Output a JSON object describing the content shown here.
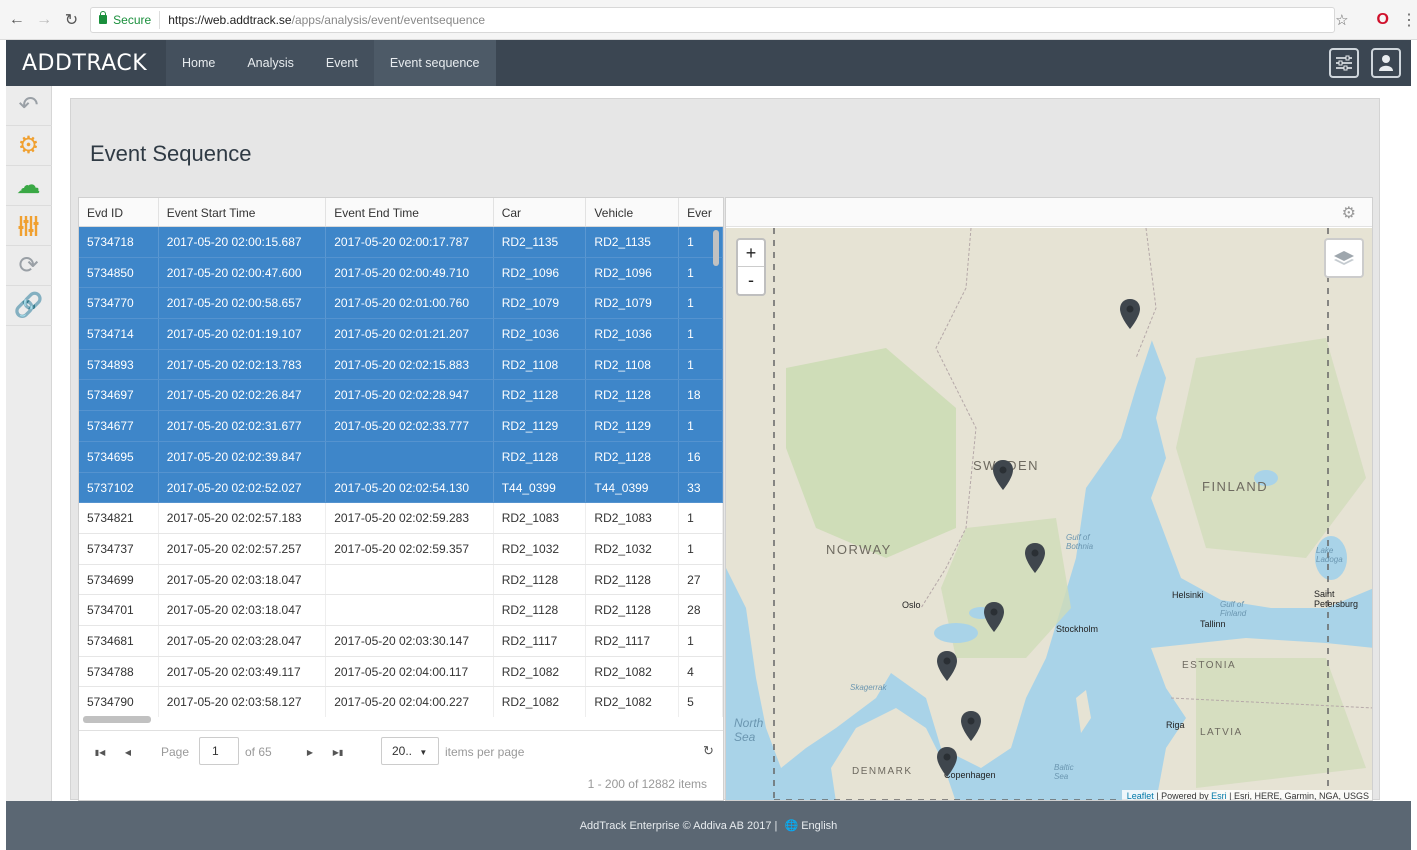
{
  "browser": {
    "secure_label": "Secure",
    "url_host": "https://web.addtrack.se",
    "url_path": "/apps/analysis/event/eventsequence"
  },
  "header": {
    "logo": "ADDTRACK",
    "nav": [
      "Home",
      "Analysis",
      "Event",
      "Event sequence"
    ]
  },
  "page": {
    "title": "Event Sequence"
  },
  "grid": {
    "columns": [
      "Evd ID",
      "Event Start Time",
      "Event End Time",
      "Car",
      "Vehicle",
      "Ever"
    ],
    "rows": [
      {
        "id": "5734718",
        "start": "2017-05-20 02:00:15.687",
        "end": "2017-05-20 02:00:17.787",
        "car": "RD2_1135",
        "vehicle": "RD2_1135",
        "ev": "1",
        "selected": true
      },
      {
        "id": "5734850",
        "start": "2017-05-20 02:00:47.600",
        "end": "2017-05-20 02:00:49.710",
        "car": "RD2_1096",
        "vehicle": "RD2_1096",
        "ev": "1",
        "selected": true
      },
      {
        "id": "5734770",
        "start": "2017-05-20 02:00:58.657",
        "end": "2017-05-20 02:01:00.760",
        "car": "RD2_1079",
        "vehicle": "RD2_1079",
        "ev": "1",
        "selected": true
      },
      {
        "id": "5734714",
        "start": "2017-05-20 02:01:19.107",
        "end": "2017-05-20 02:01:21.207",
        "car": "RD2_1036",
        "vehicle": "RD2_1036",
        "ev": "1",
        "selected": true
      },
      {
        "id": "5734893",
        "start": "2017-05-20 02:02:13.783",
        "end": "2017-05-20 02:02:15.883",
        "car": "RD2_1108",
        "vehicle": "RD2_1108",
        "ev": "1",
        "selected": true
      },
      {
        "id": "5734697",
        "start": "2017-05-20 02:02:26.847",
        "end": "2017-05-20 02:02:28.947",
        "car": "RD2_1128",
        "vehicle": "RD2_1128",
        "ev": "18",
        "selected": true
      },
      {
        "id": "5734677",
        "start": "2017-05-20 02:02:31.677",
        "end": "2017-05-20 02:02:33.777",
        "car": "RD2_1129",
        "vehicle": "RD2_1129",
        "ev": "1",
        "selected": true
      },
      {
        "id": "5734695",
        "start": "2017-05-20 02:02:39.847",
        "end": "",
        "car": "RD2_1128",
        "vehicle": "RD2_1128",
        "ev": "16",
        "selected": true
      },
      {
        "id": "5737102",
        "start": "2017-05-20 02:02:52.027",
        "end": "2017-05-20 02:02:54.130",
        "car": "T44_0399",
        "vehicle": "T44_0399",
        "ev": "33",
        "selected": true
      },
      {
        "id": "5734821",
        "start": "2017-05-20 02:02:57.183",
        "end": "2017-05-20 02:02:59.283",
        "car": "RD2_1083",
        "vehicle": "RD2_1083",
        "ev": "1",
        "selected": false
      },
      {
        "id": "5734737",
        "start": "2017-05-20 02:02:57.257",
        "end": "2017-05-20 02:02:59.357",
        "car": "RD2_1032",
        "vehicle": "RD2_1032",
        "ev": "1",
        "selected": false
      },
      {
        "id": "5734699",
        "start": "2017-05-20 02:03:18.047",
        "end": "",
        "car": "RD2_1128",
        "vehicle": "RD2_1128",
        "ev": "27",
        "selected": false
      },
      {
        "id": "5734701",
        "start": "2017-05-20 02:03:18.047",
        "end": "",
        "car": "RD2_1128",
        "vehicle": "RD2_1128",
        "ev": "28",
        "selected": false
      },
      {
        "id": "5734681",
        "start": "2017-05-20 02:03:28.047",
        "end": "2017-05-20 02:03:30.147",
        "car": "RD2_1117",
        "vehicle": "RD2_1117",
        "ev": "1",
        "selected": false
      },
      {
        "id": "5734788",
        "start": "2017-05-20 02:03:49.117",
        "end": "2017-05-20 02:04:00.117",
        "car": "RD2_1082",
        "vehicle": "RD2_1082",
        "ev": "4",
        "selected": false
      },
      {
        "id": "5734790",
        "start": "2017-05-20 02:03:58.127",
        "end": "2017-05-20 02:04:00.227",
        "car": "RD2_1082",
        "vehicle": "RD2_1082",
        "ev": "5",
        "selected": false
      }
    ]
  },
  "pager": {
    "page_label": "Page",
    "page_value": "1",
    "of_label": "of 65",
    "page_size": "20..",
    "items_per_page": "items per page",
    "info": "1 - 200 of 12882 items"
  },
  "map": {
    "zoom_in": "+",
    "zoom_out": "-",
    "labels": {
      "sweden": "SWEDEN",
      "finland": "FINLAND",
      "norway": "NORWAY",
      "estonia": "ESTONIA",
      "latvia": "LATVIA",
      "denmark": "DENMARK",
      "north_sea": "North Sea",
      "gulf_bothnia": "Gulf of Bothnia",
      "gulf_finland": "Gulf of Finland",
      "skagerrak": "Skagerrak",
      "baltic": "Baltic Sea",
      "lake_ladoga": "Lake Ladoga",
      "oslo": "Oslo",
      "stockholm": "Stockholm",
      "helsinki": "Helsinki",
      "tallinn": "Tallinn",
      "riga": "Riga",
      "saint_petersburg": "Saint Petersburg",
      "copenhagen": "Copenhagen"
    },
    "attribution": {
      "leaflet": "Leaflet",
      "powered": " | Powered by ",
      "esri": "Esri",
      "rest": " | Esri, HERE, Garmin, NGA, USGS"
    }
  },
  "footer": {
    "text": "AddTrack Enterprise © Addiva AB 2017  |",
    "language": "English"
  },
  "colors": {
    "header_bg": "#3b4652",
    "selected_row": "#3e86c9",
    "accent_orange": "#f0a030",
    "accent_green": "#3aa845",
    "footer_bg": "#5b6773"
  }
}
